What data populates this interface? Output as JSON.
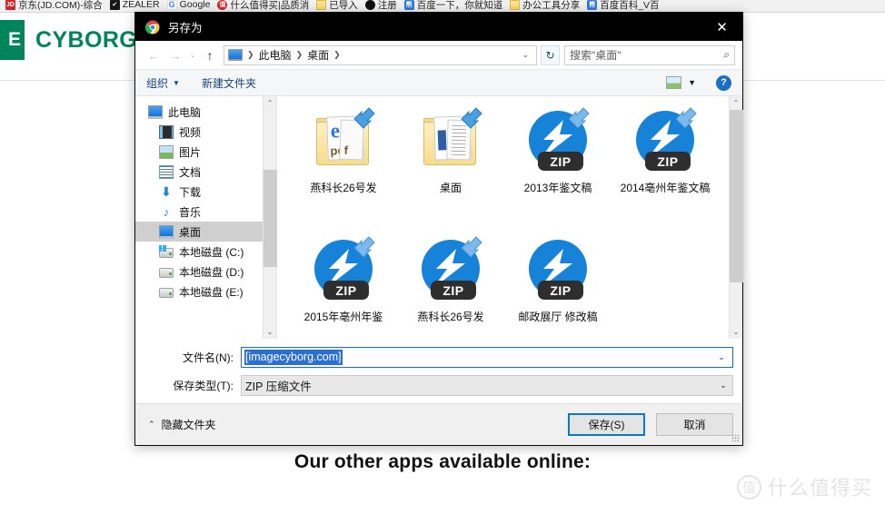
{
  "background_page": {
    "bookmarks": [
      {
        "label": "京东(JD.COM)-综合",
        "icon": "jd-icon"
      },
      {
        "label": "ZEALER",
        "icon": "zealer-icon"
      },
      {
        "label": "Google",
        "icon": "google-icon"
      },
      {
        "label": "什么值得买|品质消",
        "icon": "smzdm-icon"
      },
      {
        "label": "已导入",
        "icon": "folder-icon"
      },
      {
        "label": "注册",
        "icon": "dark-circle-icon"
      },
      {
        "label": "百度一下，你就知道",
        "icon": "baidu-icon"
      },
      {
        "label": "办公工具分享",
        "icon": "folder-icon"
      },
      {
        "label": "百度百科_V百",
        "icon": "baidu-icon"
      }
    ],
    "logo": {
      "badge": "E",
      "word": "CYBORG",
      "accent_color": "#00855a"
    },
    "tagline": "Our other apps available online:",
    "watermark": {
      "mark": "值",
      "text": "什么值得买"
    }
  },
  "dialog": {
    "title": "另存为",
    "title_icon": "chrome-icon",
    "close_label": "✕",
    "nav": {
      "back_icon": "arrow-left-icon",
      "forward_icon": "arrow-right-icon",
      "recent_icon": "chevron-down-icon",
      "up_icon": "arrow-up-icon",
      "breadcrumb_icon": "desktop-icon",
      "breadcrumb": [
        "此电脑",
        "桌面"
      ],
      "breadcrumb_trailing_sep": "❯",
      "path_dropdown_icon": "chevron-down-icon",
      "refresh_icon": "↻",
      "search_placeholder": "搜索\"桌面\"",
      "search_icon": "search-icon"
    },
    "toolbar": {
      "organize_label": "组织",
      "organize_caret": "▼",
      "new_folder_label": "新建文件夹",
      "view_icon": "view-layout-icon",
      "view_caret": "▼",
      "help_label": "?"
    },
    "nav_pane": {
      "items": [
        {
          "label": "此电脑",
          "icon": "this-pc-icon",
          "level": "root",
          "selected": false
        },
        {
          "label": "视频",
          "icon": "videos-icon",
          "level": "child",
          "selected": false
        },
        {
          "label": "图片",
          "icon": "pictures-icon",
          "level": "child",
          "selected": false
        },
        {
          "label": "文档",
          "icon": "documents-icon",
          "level": "child",
          "selected": false
        },
        {
          "label": "下载",
          "icon": "downloads-icon",
          "level": "child",
          "selected": false
        },
        {
          "label": "音乐",
          "icon": "music-icon",
          "level": "child",
          "selected": false
        },
        {
          "label": "桌面",
          "icon": "desktop-icon",
          "level": "child",
          "selected": true
        },
        {
          "label": "本地磁盘 (C:)",
          "icon": "system-disk-icon",
          "level": "child",
          "selected": false
        },
        {
          "label": "本地磁盘 (D:)",
          "icon": "disk-icon",
          "level": "child",
          "selected": false
        },
        {
          "label": "本地磁盘 (E:)",
          "icon": "disk-icon",
          "level": "child",
          "selected": false
        }
      ]
    },
    "files": [
      {
        "name": "燕科长26号发",
        "type": "folder-pdf",
        "icon": "folder-with-pdf-icon"
      },
      {
        "name": "桌面",
        "type": "folder-doc",
        "icon": "folder-with-docs-icon"
      },
      {
        "name": "2013年鉴文稿",
        "type": "zip",
        "icon": "zip-archive-icon",
        "badge": "ZIP"
      },
      {
        "name": "2014亳州年鉴文稿",
        "type": "zip",
        "icon": "zip-archive-icon",
        "badge": "ZIP"
      },
      {
        "name": "2015年亳州年鉴",
        "type": "zip",
        "icon": "zip-archive-icon",
        "badge": "ZIP"
      },
      {
        "name": "燕科长26号发",
        "type": "zip",
        "icon": "zip-archive-icon",
        "badge": "ZIP"
      },
      {
        "name": "邮政展厅 修改稿",
        "type": "zip",
        "icon": "zip-archive-icon",
        "badge": "ZIP"
      }
    ],
    "form": {
      "filename_label": "文件名(N):",
      "filename_value": "[imagecyborg.com]",
      "filename_selected": true,
      "filetype_label": "保存类型(T):",
      "filetype_value": "ZIP 压缩文件",
      "combo_caret": "⌄"
    },
    "footer": {
      "hide_folders_label": "隐藏文件夹",
      "hide_folders_caret": "⌃",
      "save_label": "保存(S)",
      "cancel_label": "取消"
    },
    "scrollbars": {
      "up_arrow": "⌃",
      "down_arrow": "⌄"
    },
    "accent_color": "#0a78c8",
    "selection_color": "#2a6fd1"
  }
}
